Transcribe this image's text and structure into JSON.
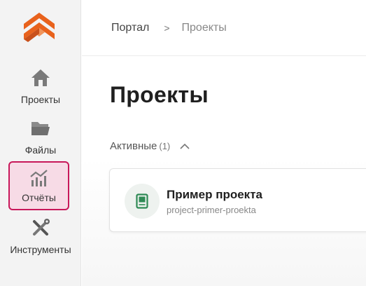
{
  "sidebar": {
    "logo_icon": "chevron-stack-logo",
    "items": [
      {
        "label": "Проекты",
        "icon": "home-icon",
        "active": false
      },
      {
        "label": "Файлы",
        "icon": "folder-icon",
        "active": false
      },
      {
        "label": "Отчёты",
        "icon": "chart-icon",
        "active": true
      },
      {
        "label": "Инструменты",
        "icon": "tools-icon",
        "active": false
      }
    ]
  },
  "header": {
    "breadcrumb": {
      "root": "Портал",
      "separator": ">",
      "current": "Проекты"
    }
  },
  "main": {
    "title": "Проекты",
    "section": {
      "label": "Активные",
      "count": "(1)",
      "collapse_icon": "chevron-up-icon"
    },
    "projects": [
      {
        "name": "Пример проекта",
        "slug": "project-primer-proekta",
        "icon": "book-icon"
      }
    ]
  },
  "colors": {
    "accent": "#c8185a",
    "active_bg": "#f7dbe6",
    "logo_orange": "#e8621c",
    "icon_gray": "#7a7a7a",
    "project_icon_green": "#2f8a55"
  }
}
